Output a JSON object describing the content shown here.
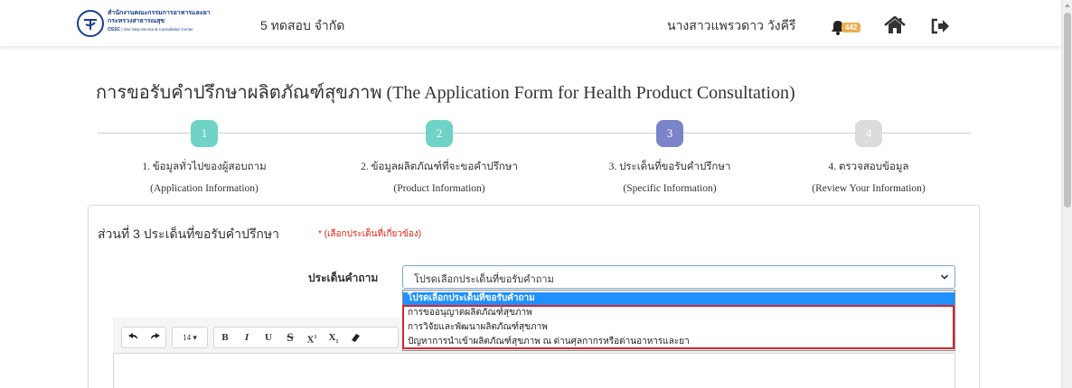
{
  "navbar": {
    "org_line1": "สำนักงานคณะกรรมการอาหารและยา",
    "org_line2": "กระทรวงสาธารณสุข",
    "org_line3_bold": "OSSC",
    "org_line3_rest": " | One Stop Service & Consultation Center",
    "company": "5 ทดสอบ จำกัด",
    "username": "นางสาวแพรวดาว วังคีรี",
    "notification_count": "442",
    "icons": [
      "bell-icon",
      "home-icon",
      "sign-out-icon"
    ],
    "colors": {
      "logo": "#1b3f8f",
      "badge": "#f0ad4e"
    }
  },
  "page": {
    "title": "การขอรับคำปรึกษาผลิตภัณฑ์สุขภาพ (The Application Form for Health Product Consultation)"
  },
  "stepper": {
    "steps": [
      {
        "number": "1",
        "label": "1. ข้อมูลทั่วไปของผู้สอบถาม",
        "sub": "(Application Information)",
        "color": "#6fd3c7"
      },
      {
        "number": "2",
        "label": "2. ข้อมูลผลิตภัณฑ์ที่จะขอคำปรึกษา",
        "sub": "(Product Information)",
        "color": "#6fd3c7"
      },
      {
        "number": "3",
        "label": "3. ประเด็นที่ขอรับคำปรึกษา",
        "sub": "(Specific Information)",
        "color": "#7b83c9"
      },
      {
        "number": "4",
        "label": "4. ตรวจสอบข้อมูล",
        "sub": "(Review Your Information)",
        "color": "#dcdcdc"
      }
    ]
  },
  "section": {
    "title": "ส่วนที่ 3 ประเด็นที่ขอรับคำปรึกษา",
    "hint": "* (เลือกประเด็นที่เกี่ยวข้อง)"
  },
  "form": {
    "question_label": "ประเด็นคำถาม",
    "select_value": "โปรดเลือกประเด็นที่ขอรับคำถาม",
    "options": [
      "โปรดเลือกประเด็นที่ขอรับคำถาม",
      "การขออนุญาตผลิตภัณฑ์สุขภาพ",
      "การวิจัยและพัฒนาผลิตภัณฑ์สุขภาพ",
      "ปัญหาการนำเข้าผลิตภัณฑ์สุขภาพ ณ ด่านศุลกากรหรือด่านอาหารและยา"
    ],
    "selected_color": "#1e90ff",
    "highlight_color": "#d9232e"
  },
  "editor": {
    "font_size": "14",
    "buttons": [
      "undo-icon",
      "redo-icon",
      "bold",
      "italic",
      "underline",
      "strikethrough",
      "superscript",
      "subscript",
      "eraser-icon"
    ],
    "bold": "B",
    "italic": "I",
    "underline": "U",
    "strike": "S",
    "sup": "X",
    "sub": "X"
  }
}
